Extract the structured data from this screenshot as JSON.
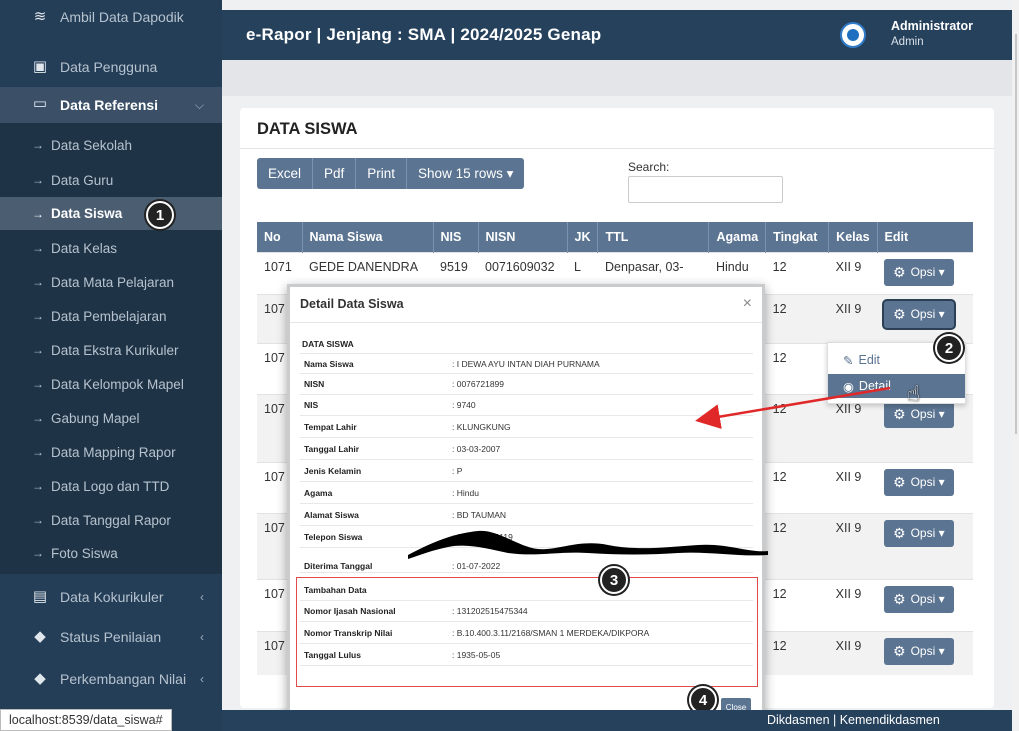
{
  "sidebar": {
    "items": [
      {
        "label": "Ambil Data Dapodik",
        "icon": "database-icon"
      },
      {
        "label": "Data Pengguna",
        "icon": "id-card-icon"
      },
      {
        "label": "Data Referensi",
        "icon": "laptop-icon"
      },
      {
        "label": "Data Sekolah"
      },
      {
        "label": "Data Guru"
      },
      {
        "label": "Data Siswa"
      },
      {
        "label": "Data Kelas"
      },
      {
        "label": "Data Mata Pelajaran"
      },
      {
        "label": "Data Pembelajaran"
      },
      {
        "label": "Data Ekstra Kurikuler"
      },
      {
        "label": "Data Kelompok Mapel"
      },
      {
        "label": "Gabung Mapel"
      },
      {
        "label": "Data Mapping Rapor"
      },
      {
        "label": "Data Logo dan TTD"
      },
      {
        "label": "Data Tanggal Rapor"
      },
      {
        "label": "Foto Siswa"
      },
      {
        "label": "Data Kokurikuler",
        "icon": "book-icon"
      },
      {
        "label": "Status Penilaian",
        "icon": "graduation-cap-icon"
      },
      {
        "label": "Perkembangan Nilai",
        "icon": "graduation-cap-icon"
      }
    ]
  },
  "header": {
    "title": "e-Rapor | Jenjang : SMA | 2024/2025 Genap",
    "user_name": "Administrator",
    "user_role": "Admin"
  },
  "card": {
    "title": "DATA SISWA",
    "buttons": {
      "excel": "Excel",
      "pdf": "Pdf",
      "print": "Print",
      "show_rows": "Show 15 rows ▾"
    },
    "search_label": "Search:",
    "search_value": ""
  },
  "table": {
    "headers": [
      "No",
      "Nama Siswa",
      "NIS",
      "NISN",
      "JK",
      "TTL",
      "Agama",
      "Tingkat",
      "Kelas",
      "Edit"
    ],
    "opsi_label": "Opsi ▾",
    "rows": [
      {
        "no": "1071",
        "nama": "GEDE DANENDRA",
        "nis": "9519",
        "nisn": "0071609032",
        "jk": "L",
        "ttl": "Denpasar, 03-",
        "agama": "Hindu",
        "tingkat": "12",
        "kelas": "XII 9"
      },
      {
        "no": "107",
        "tingkat": "12",
        "kelas": "XII 9"
      },
      {
        "no": "107",
        "tingkat": "12",
        "kelas": ""
      },
      {
        "no": "107",
        "tingkat": "12",
        "kelas": "XII 9"
      },
      {
        "no": "107",
        "tingkat": "12",
        "kelas": "XII 9"
      },
      {
        "no": "107",
        "tingkat": "12",
        "kelas": "XII 9"
      },
      {
        "no": "107",
        "tingkat": "12",
        "kelas": "XII 9"
      },
      {
        "no": "107",
        "tingkat": "12",
        "kelas": "XII 9"
      }
    ]
  },
  "dropdown": {
    "edit": "Edit",
    "detail": "Detail"
  },
  "modal": {
    "title": "Detail Data Siswa",
    "close_x": "×",
    "section": "DATA SISWA",
    "fields": [
      {
        "k": "Nama Siswa",
        "v": ": I DEWA AYU INTAN DIAH PURNAMA"
      },
      {
        "k": "NISN",
        "v": ": 0076721899"
      },
      {
        "k": "NIS",
        "v": ": 9740"
      },
      {
        "k": "Tempat Lahir",
        "v": ": KLUNGKUNG"
      },
      {
        "k": "Tanggal Lahir",
        "v": ": 03-03-2007"
      },
      {
        "k": "Jenis Kelamin",
        "v": ": P"
      },
      {
        "k": "Agama",
        "v": ": Hindu"
      },
      {
        "k": "Alamat Siswa",
        "v": ": BD TAUMAN"
      },
      {
        "k": "Telepon Siswa",
        "v": ": 081916424119"
      },
      {
        "k": "Diterima Tanggal",
        "v": ": 01-07-2022"
      }
    ],
    "extra_title": "Tambahan Data",
    "extra_fields": [
      {
        "k": "Nomor Ijasah Nasional",
        "v": ": 131202515475344"
      },
      {
        "k": "Nomor Transkrip Nilai",
        "v": ": B.10.400.3.11/2168/SMAN 1 MERDEKA/DIKPORA"
      },
      {
        "k": "Tanggal Lulus",
        "v": ": 1935-05-05"
      }
    ],
    "close_button": "Close"
  },
  "footer": {
    "text": "Dikdasmen | Kemendikdasmen"
  },
  "status_url": "localhost:8539/data_siswa#",
  "annotations": {
    "b1": "1",
    "b2": "2",
    "b3": "3",
    "b4": "4"
  },
  "colors": {
    "sidebar": "#253e57",
    "header": "#26415c",
    "accent": "#5b7491",
    "annotation_red": "#e04a4a"
  }
}
